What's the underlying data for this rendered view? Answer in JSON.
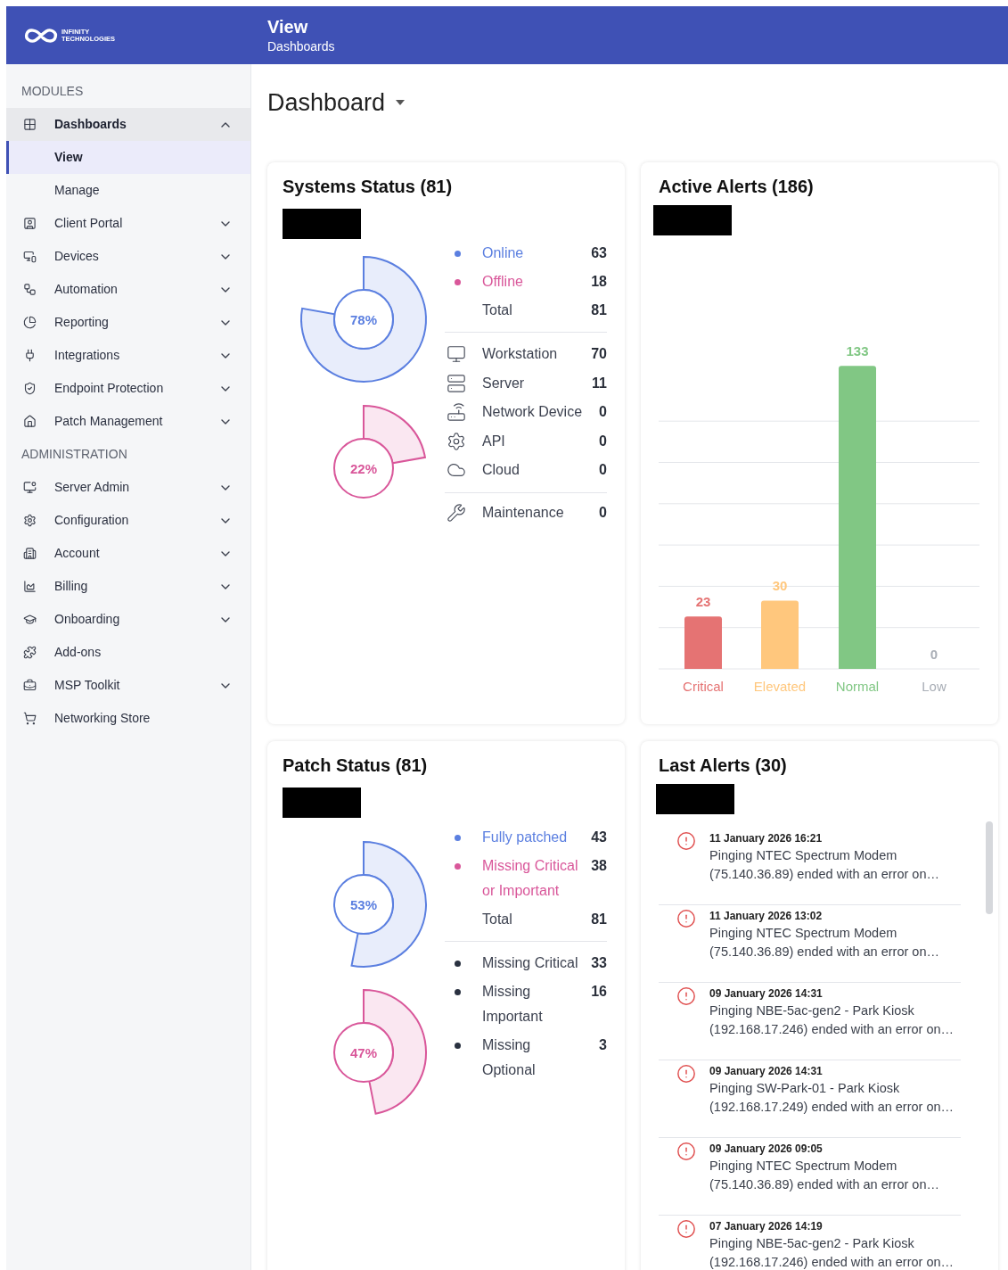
{
  "header": {
    "logo": [
      "INFINITY",
      "TECHNOLOGIES"
    ],
    "title": "View",
    "subtitle": "Dashboards"
  },
  "sidebar": {
    "sections": [
      {
        "title": "MODULES",
        "items": [
          {
            "label": "Dashboards",
            "kind": "group",
            "expanded": true,
            "children": [
              {
                "label": "View",
                "selected": true
              },
              {
                "label": "Manage",
                "selected": false
              }
            ]
          },
          {
            "label": "Client Portal",
            "kind": "group",
            "expanded": false
          },
          {
            "label": "Devices",
            "kind": "group",
            "expanded": false
          },
          {
            "label": "Automation",
            "kind": "group",
            "expanded": false
          },
          {
            "label": "Reporting",
            "kind": "group",
            "expanded": false
          },
          {
            "label": "Integrations",
            "kind": "group",
            "expanded": false
          },
          {
            "label": "Endpoint Protection",
            "kind": "group",
            "expanded": false
          },
          {
            "label": "Patch Management",
            "kind": "group",
            "expanded": false
          }
        ]
      },
      {
        "title": "ADMINISTRATION",
        "items": [
          {
            "label": "Server Admin",
            "kind": "group",
            "expanded": false
          },
          {
            "label": "Configuration",
            "kind": "group",
            "expanded": false
          },
          {
            "label": "Account",
            "kind": "group",
            "expanded": false
          },
          {
            "label": "Billing",
            "kind": "group",
            "expanded": false
          },
          {
            "label": "Onboarding",
            "kind": "group",
            "expanded": false
          },
          {
            "label": "Add-ons",
            "kind": "link"
          },
          {
            "label": "MSP Toolkit",
            "kind": "group",
            "expanded": false
          },
          {
            "label": "Networking Store",
            "kind": "link"
          }
        ]
      }
    ]
  },
  "page_title": "Dashboard",
  "systems_status": {
    "title": "Systems Status (81)",
    "gauge_readings": [
      "78%",
      "22%"
    ],
    "status_rows": [
      {
        "label": "Online",
        "value": "63",
        "color": "#5b7fe0"
      },
      {
        "label": "Offline",
        "value": "18",
        "color": "#d9579a"
      }
    ],
    "total": {
      "label": "Total",
      "value": "81"
    },
    "type_rows": [
      {
        "label": "Workstation",
        "value": "70"
      },
      {
        "label": "Server",
        "value": "11"
      },
      {
        "label": "Network Device",
        "value": "0"
      },
      {
        "label": "API",
        "value": "0"
      },
      {
        "label": "Cloud",
        "value": "0"
      }
    ],
    "maintenance": {
      "label": "Maintenance",
      "value": "0"
    }
  },
  "active_alerts": {
    "title": "Active Alerts (186)",
    "chart_data": {
      "type": "bar",
      "categories": [
        "Critical",
        "Elevated",
        "Normal",
        "Low"
      ],
      "values": [
        23,
        30,
        133,
        0
      ],
      "data_labels": true
    }
  },
  "patch_status": {
    "title": "Patch Status (81)",
    "gauge_readings": [
      "53%",
      "47%"
    ],
    "status_rows": [
      {
        "label": "Fully patched",
        "value": "43",
        "color": "#5b7fe0"
      },
      {
        "label": "Missing Critical or Important",
        "value": "38",
        "color": "#d9579a"
      }
    ],
    "total": {
      "label": "Total",
      "value": "81"
    },
    "detail_rows": [
      {
        "label": "Missing Critical",
        "value": "33"
      },
      {
        "label": "Missing Important",
        "value": "16"
      },
      {
        "label": "Missing Optional",
        "value": "3"
      }
    ]
  },
  "last_alerts": {
    "title": "Last Alerts (30)",
    "items": [
      {
        "time": "11 January 2026 16:21",
        "text": "Pinging NTEC Spectrum Modem (75.140.36.89) ended with an error on…"
      },
      {
        "time": "11 January 2026 13:02",
        "text": "Pinging NTEC Spectrum Modem (75.140.36.89) ended with an error on…"
      },
      {
        "time": "09 January 2026 14:31",
        "text": "Pinging NBE-5ac-gen2 - Park Kiosk (192.168.17.246) ended with an error on…"
      },
      {
        "time": "09 January 2026 14:31",
        "text": "Pinging SW-Park-01 - Park Kiosk (192.168.17.249) ended with an error on…"
      },
      {
        "time": "09 January 2026 09:05",
        "text": "Pinging NTEC Spectrum Modem (75.140.36.89) ended with an error on…"
      },
      {
        "time": "07 January 2026 14:19",
        "text": "Pinging NBE-5ac-gen2 - Park Kiosk (192.168.17.246) ended with an error on…"
      }
    ]
  }
}
